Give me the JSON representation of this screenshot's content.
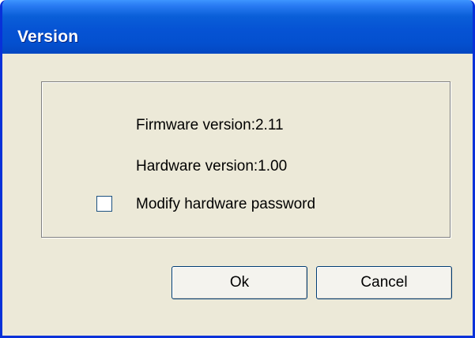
{
  "window": {
    "title": "Version"
  },
  "info": {
    "firmware": "Firmware version:2.11",
    "hardware": "Hardware version:1.00"
  },
  "options": {
    "modify_password_label": "Modify hardware password",
    "modify_password_checked": false
  },
  "buttons": {
    "ok_label": "Ok",
    "cancel_label": "Cancel"
  },
  "colors": {
    "titlebar": "#0653d4",
    "dialog_background": "#ece9d8",
    "button_border": "#003c74"
  }
}
